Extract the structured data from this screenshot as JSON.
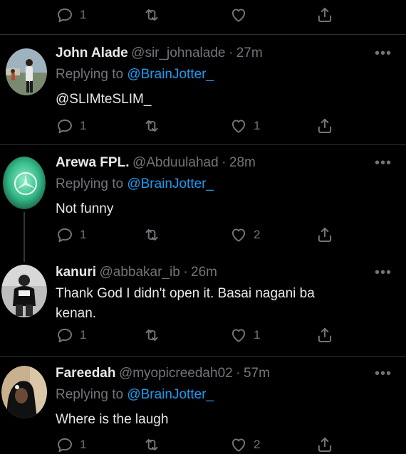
{
  "top_actions": {
    "reply": "1",
    "retweet": "",
    "like": "",
    "share": ""
  },
  "tweets": [
    {
      "name": "John Alade",
      "handle": "@sir_johnalade",
      "time": "27m",
      "replying_prefix": "Replying to",
      "replying_to": "@BrainJotter_",
      "text": "@SLIMteSLIM_",
      "reply_count": "1",
      "retweet_count": "",
      "like_count": "1"
    },
    {
      "name": "Arewa FPL.",
      "handle": "@Abduulahad",
      "time": "28m",
      "replying_prefix": "Replying to",
      "replying_to": "@BrainJotter_",
      "text": "Not funny",
      "reply_count": "1",
      "retweet_count": "",
      "like_count": "2"
    },
    {
      "name": "kanuri",
      "handle": "@abbakar_ib",
      "time": "26m",
      "text_line1": "Thank God I didn't open it. Basai nagani ba",
      "text_line2": "kenan.",
      "reply_count": "1",
      "retweet_count": "",
      "like_count": "1"
    },
    {
      "name": "Fareedah",
      "handle": "@myopicreedah02",
      "time": "57m",
      "replying_prefix": "Replying to",
      "replying_to": "@BrainJotter_",
      "text": "Where is the laugh",
      "reply_count": "1",
      "retweet_count": "",
      "like_count": "2"
    }
  ],
  "more_label": "•••",
  "dot_sep": "·",
  "icons": [
    "reply-icon",
    "retweet-icon",
    "like-icon",
    "share-icon",
    "more-icon"
  ],
  "colors": {
    "background": "#000000",
    "muted": "#71767b",
    "link": "#1d9bf0",
    "text": "#e7e9ea"
  }
}
